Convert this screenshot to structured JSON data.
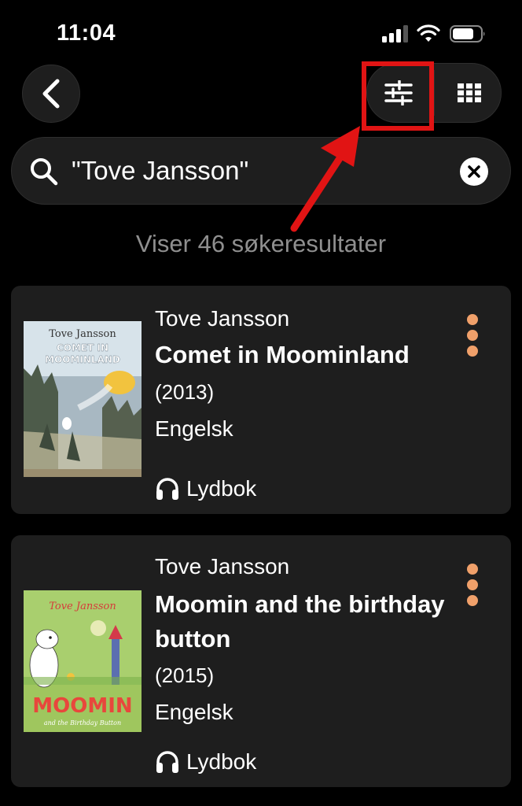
{
  "status_bar": {
    "time": "11:04"
  },
  "search": {
    "query": "\"Tove Jansson\""
  },
  "result_count_text": "Viser 46 søkeresultater",
  "results": [
    {
      "author": "Tove Jansson",
      "title": "Comet in Moominland",
      "year": "(2013)",
      "language": "Engelsk",
      "format": "Lydbok",
      "cover": {
        "author": "Tove Jansson",
        "title_line1": "COMET IN",
        "title_line2": "MOOMINLAND"
      }
    },
    {
      "author": "Tove Jansson",
      "title": "Moomin and the birthday button",
      "year": "(2015)",
      "language": "Engelsk",
      "format": "Lydbok",
      "cover": {
        "author": "Tove Jansson",
        "title_big": "MOOMIN",
        "subtitle": "and the Birthday Button"
      }
    }
  ],
  "colors": {
    "accent": "#f0a06a",
    "annotation": "#e11414",
    "card_bg": "#1e1e1e",
    "muted_text": "#8f8f8f"
  },
  "icons": [
    "back-icon",
    "filter-icon",
    "grid-icon",
    "search-icon",
    "clear-icon",
    "headphones-icon",
    "more-icon"
  ]
}
